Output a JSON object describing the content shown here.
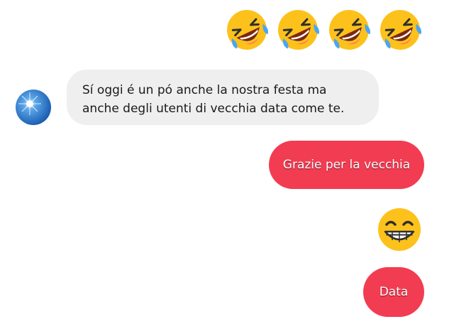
{
  "conversation": {
    "reaction_emojis": [
      {
        "icon": "rolling-on-floor-laughing-icon"
      },
      {
        "icon": "rolling-on-floor-laughing-icon"
      },
      {
        "icon": "rolling-on-floor-laughing-icon"
      },
      {
        "icon": "rolling-on-floor-laughing-icon"
      }
    ],
    "incoming_message": {
      "avatar_icon": "sun-sky-avatar",
      "text": "Sí oggi é un pó anche la nostra festa ma anche degli utenti di vecchia data come te."
    },
    "outgoing_messages": [
      {
        "text": "Grazie per la vecchia"
      },
      {
        "icon": "grinning-face-icon"
      },
      {
        "text": "Data"
      }
    ]
  },
  "colors": {
    "outgoing_bubble": "#f23c52",
    "incoming_bubble": "#efefef",
    "background": "#ffffff"
  }
}
